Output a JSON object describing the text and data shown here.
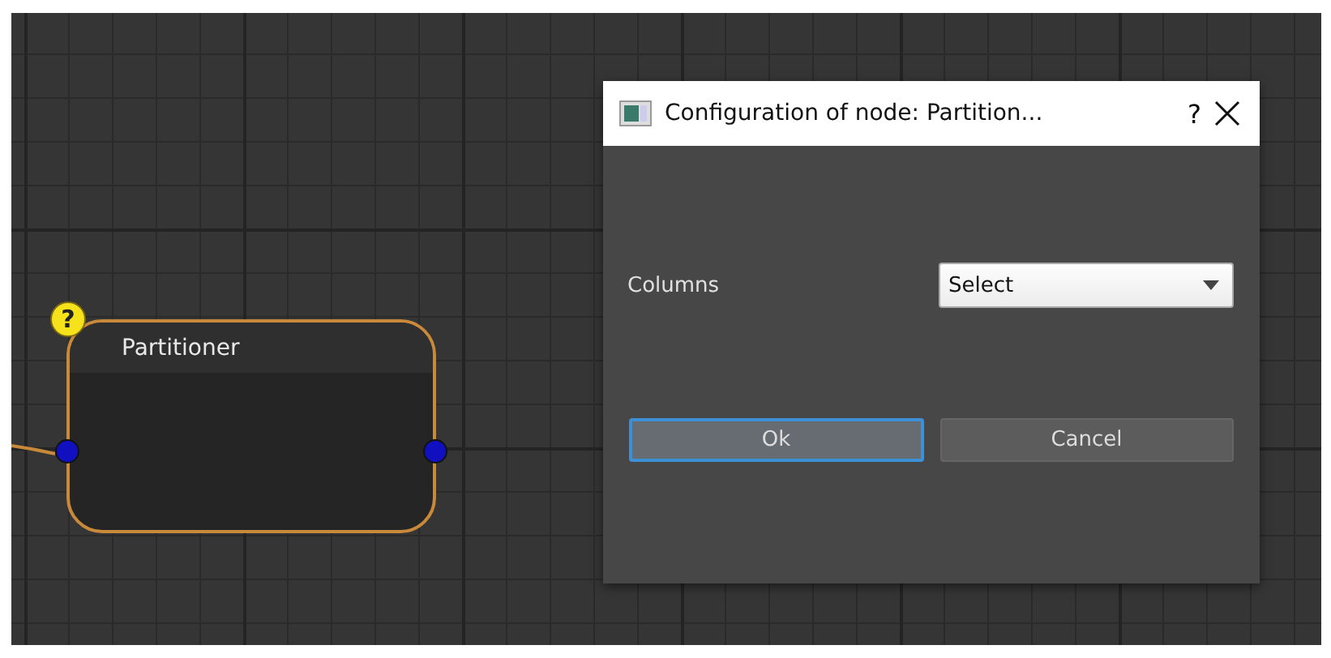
{
  "canvas": {
    "nodes": [
      {
        "title": "Partitioner",
        "badge": "?",
        "has_input_edge": true
      }
    ]
  },
  "dialog": {
    "title": "Configuration of node: Partition...",
    "help": "?",
    "fields": [
      {
        "label": "Columns",
        "kind": "dropdown",
        "value": "Select"
      }
    ],
    "buttons": [
      {
        "label": "Ok",
        "focused": true
      },
      {
        "label": "Cancel",
        "focused": false
      }
    ]
  }
}
